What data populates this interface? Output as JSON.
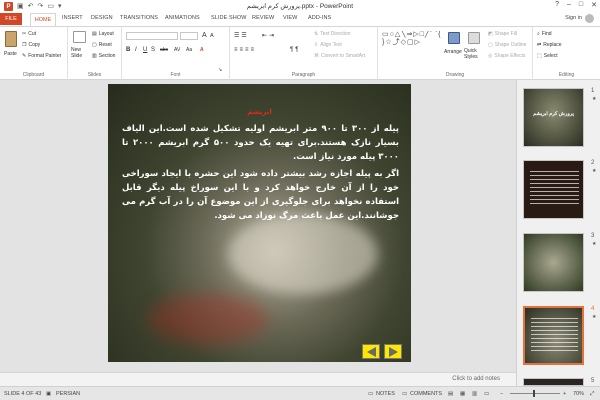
{
  "window": {
    "title": "پرورش کرم ابریشم.pptx - PowerPoint",
    "controls": [
      "?",
      "–",
      "□",
      "✕"
    ]
  },
  "tabs": {
    "file": "FILE",
    "home": "HOME",
    "items": [
      "INSERT",
      "DESIGN",
      "TRANSITIONS",
      "ANIMATIONS",
      "SLIDE SHOW",
      "REVIEW",
      "VIEW",
      "ADD-INS"
    ],
    "sign_in": "Sign in"
  },
  "ribbon": {
    "clipboard": {
      "paste": "Paste",
      "cut": "Cut",
      "copy": "Copy",
      "format_painter": "Format Painter",
      "label": "Clipboard"
    },
    "slides": {
      "new_slide": "New Slide",
      "layout": "Layout",
      "reset": "Reset",
      "section": "Section",
      "label": "Slides"
    },
    "font": {
      "label": "Font",
      "size_a": "A",
      "bold": "B",
      "italic": "I",
      "underline": "U",
      "strike": "S",
      "abc": "abc",
      "av": "AV",
      "aa": "Aa"
    },
    "paragraph": {
      "label": "Paragraph",
      "text_direction": "Text Direction",
      "align_text": "Align Text",
      "convert_smartart": "Convert to SmartArt"
    },
    "drawing": {
      "label": "Drawing",
      "arrange": "Arrange",
      "quick_styles": "Quick Styles",
      "shape_fill": "Shape Fill",
      "shape_outline": "Shape Outline",
      "shape_effects": "Shape Effects"
    },
    "editing": {
      "label": "Editing",
      "find": "Find",
      "replace": "Replace",
      "select": "Select"
    }
  },
  "slide": {
    "title": "ابریشم",
    "paragraphs": [
      "پیله از ۳۰۰ تا ۹۰۰ متر ابریشم اولیه تشکیل شده است.این الیاف بسیار نازک هستند.برای تهیه یک حدود ۵۰۰ گرم ابریشم ۲۰۰۰ تا ۳۰۰۰ پیله مورد نیاز است.",
      "اگر به پیله اجازه رشد بیشتر داده شود این حشره با ایجاد سوراخی خود را از آن خارج خواهد کرد و با این سوراخ پیله دیگر قابل استفاده نخواهد برای جلوگیری از این موضوع آن را در آب گرم می جوشانند.این عمل باعث مرگ نوزاد می شود."
    ]
  },
  "thumbnails": [
    {
      "number": "1",
      "title": "پرورش کرم ابریشم"
    },
    {
      "number": "2",
      "title": ""
    },
    {
      "number": "3",
      "title": ""
    },
    {
      "number": "4",
      "title": ""
    },
    {
      "number": "5",
      "title": ""
    }
  ],
  "notes": {
    "placeholder": "Click to add notes"
  },
  "status": {
    "slide_info": "SLIDE 4 OF 43",
    "language": "PERSIAN",
    "notes": "NOTES",
    "comments": "COMMENTS",
    "zoom": "70%"
  },
  "colors": {
    "accent": "#d24726",
    "slide_title": "#e02a1a",
    "nav_buttons": "#ffe600",
    "selected_thumb_border": "#e4723c"
  }
}
